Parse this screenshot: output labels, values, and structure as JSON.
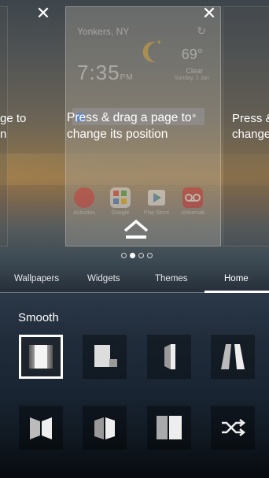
{
  "hint": "Press & drag a page to change its position",
  "left_page_hint": {
    "line1": "ge to",
    "line2": "n"
  },
  "right_page_hint": {
    "line1": "Press &",
    "line2": "change"
  },
  "weather": {
    "city": "Yonkers, NY",
    "time": "7:35",
    "ampm": "PM",
    "temp": "69°",
    "condition": "Clear",
    "date": "Sunday, 1 Jan"
  },
  "apps": [
    {
      "name": "Activities",
      "color": "#d9262c"
    },
    {
      "name": "Google",
      "color": "#f2f2f2"
    },
    {
      "name": "Play Store",
      "color": "#ffffff"
    },
    {
      "name": "Voicemail",
      "color": "#d41f26"
    }
  ],
  "page_indicator": {
    "count": 4,
    "active": 1
  },
  "tabs": [
    {
      "label": "Wallpapers"
    },
    {
      "label": "Widgets"
    },
    {
      "label": "Themes"
    },
    {
      "label": "Home"
    }
  ],
  "active_tab": "Home",
  "section_title": "Smooth",
  "transition_effects": [
    {
      "icon": "smooth-effect-icon",
      "selected": true
    },
    {
      "icon": "cascade-effect-icon",
      "selected": false
    },
    {
      "icon": "card-flip-effect-icon",
      "selected": false
    },
    {
      "icon": "perspective-effect-icon",
      "selected": false
    },
    {
      "icon": "cube-in-effect-icon",
      "selected": false
    },
    {
      "icon": "cube-out-effect-icon",
      "selected": false
    },
    {
      "icon": "book-effect-icon",
      "selected": false
    },
    {
      "icon": "random-effect-icon",
      "selected": false
    }
  ],
  "colors": {
    "accent": "#ffffff",
    "text": "#e8e8e8"
  }
}
